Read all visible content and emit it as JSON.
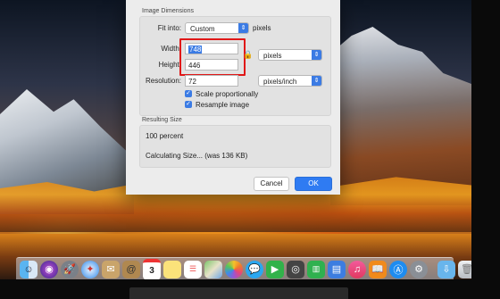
{
  "dialog": {
    "image_dimensions_title": "Image Dimensions",
    "fit_into_label": "Fit into:",
    "fit_into_value": "Custom",
    "fit_into_units": "pixels",
    "width_label": "Width:",
    "width_value": "748",
    "height_label": "Height:",
    "height_value": "446",
    "dimension_units": "pixels",
    "resolution_label": "Resolution:",
    "resolution_value": "72",
    "resolution_units": "pixels/inch",
    "scale_label": "Scale proportionally",
    "resample_label": "Resample image",
    "resulting_size_title": "Resulting Size",
    "percent_text": "100 percent",
    "calculating_text": "Calculating Size... (was 136 KB)",
    "cancel_label": "Cancel",
    "ok_label": "OK"
  },
  "dock_icons": [
    "finder-icon",
    "siri-icon",
    "launchpad-icon",
    "safari-icon",
    "mail-stamp-icon",
    "contacts-icon",
    "calendar-icon",
    "notes-icon",
    "reminders-icon",
    "maps-icon",
    "photos-icon",
    "messages-icon",
    "facetime-icon",
    "photo-booth-icon",
    "numbers-icon",
    "keynote-icon",
    "itunes-icon",
    "ibooks-icon",
    "app-store-icon",
    "system-preferences-icon",
    "downloads-folder-icon",
    "trash-icon"
  ],
  "dock_calendar_day": "3",
  "colors": {
    "accent": "#3b7be4",
    "highlight": "#e01818"
  }
}
